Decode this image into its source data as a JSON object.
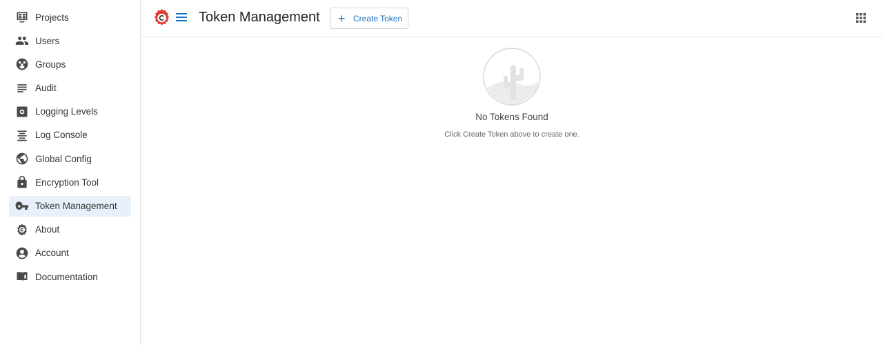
{
  "sidebar": {
    "items": [
      {
        "label": "Projects",
        "icon": "projects-icon"
      },
      {
        "label": "Users",
        "icon": "users-icon"
      },
      {
        "label": "Groups",
        "icon": "groups-icon"
      },
      {
        "label": "Audit",
        "icon": "audit-icon"
      },
      {
        "label": "Logging Levels",
        "icon": "logging-levels-icon"
      },
      {
        "label": "Log Console",
        "icon": "log-console-icon"
      },
      {
        "label": "Global Config",
        "icon": "globe-icon"
      },
      {
        "label": "Encryption Tool",
        "icon": "lock-icon"
      },
      {
        "label": "Token Management",
        "icon": "key-icon",
        "active": true
      },
      {
        "label": "About",
        "icon": "about-icon"
      },
      {
        "label": "Account",
        "icon": "account-icon"
      },
      {
        "label": "Documentation",
        "icon": "documentation-icon"
      }
    ]
  },
  "header": {
    "title": "Token Management",
    "create_button_label": "Create Token",
    "create_button_icon": "plus-icon",
    "apps_icon": "apps-grid-icon"
  },
  "empty_state": {
    "title": "No Tokens Found",
    "subtitle": "Click Create Token above to create one.",
    "illustration": "cactus-illustration"
  },
  "colors": {
    "accent": "#1a73c7",
    "active_nav_bg": "#e8f1fb",
    "logo_red": "#e03a2f"
  }
}
